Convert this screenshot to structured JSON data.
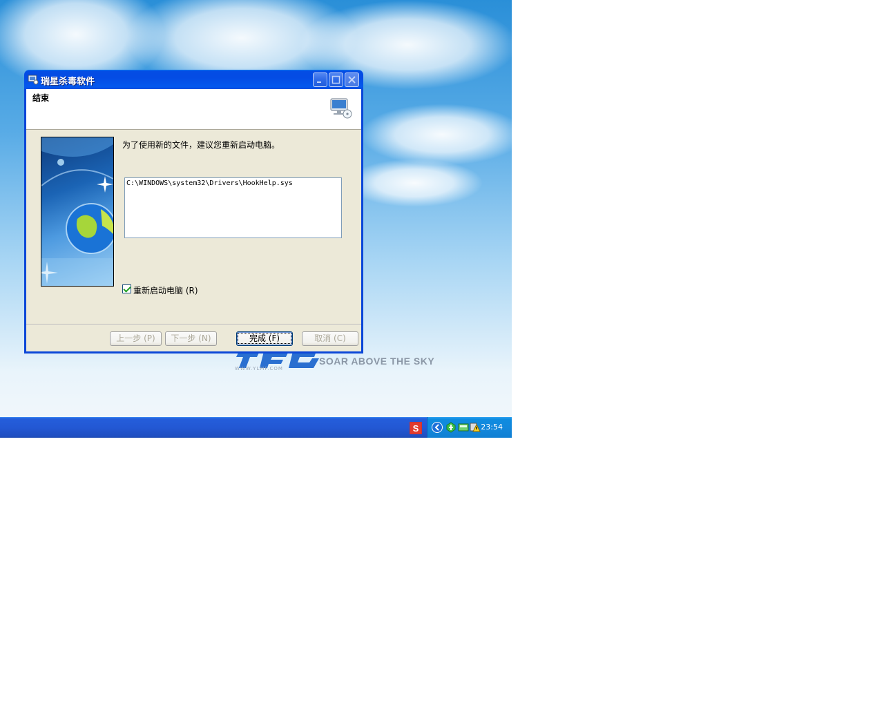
{
  "window": {
    "title": "瑞星杀毒软件",
    "header_title": "结束",
    "message": "为了使用新的文件，建议您重新启动电脑。",
    "file_list": [
      "C:\\WINDOWS\\system32\\Drivers\\HookHelp.sys"
    ],
    "restart_checkbox": {
      "label": "重新启动电脑 (R)",
      "checked": true
    },
    "buttons": {
      "back": "上一步 (P)",
      "next": "下一步 (N)",
      "finish": "完成 (F)",
      "cancel": "取消 (C)"
    }
  },
  "desktop": {
    "brand_slogan": "SOAR ABOVE THE SKY",
    "brand_url": "WWW.YLMF.COM"
  },
  "taskbar": {
    "clock": "23:54"
  },
  "colors": {
    "titlebar": "#0a46d8",
    "taskbar": "#245edb",
    "tray": "#0f8ce0",
    "dialog_bg": "#ece9d8"
  }
}
